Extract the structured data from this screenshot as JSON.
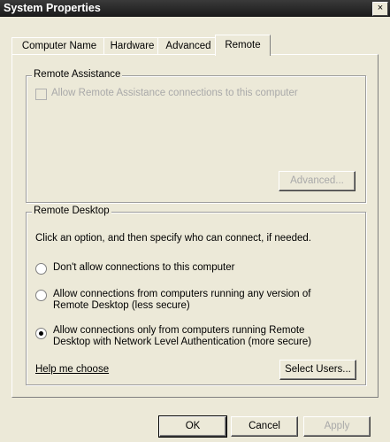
{
  "window": {
    "title": "System Properties",
    "close_glyph": "×"
  },
  "tabs": [
    {
      "label": "Computer Name",
      "active": false
    },
    {
      "label": "Hardware",
      "active": false
    },
    {
      "label": "Advanced",
      "active": false
    },
    {
      "label": "Remote",
      "active": true
    }
  ],
  "remote_assistance": {
    "legend": "Remote Assistance",
    "checkbox_label": "Allow Remote Assistance connections to this computer",
    "checkbox_checked": false,
    "advanced_button": "Advanced..."
  },
  "remote_desktop": {
    "legend": "Remote Desktop",
    "instruction": "Click an option, and then specify who can connect, if needed.",
    "options": [
      {
        "line1": "Don't allow connections to this computer",
        "line2": "",
        "selected": false
      },
      {
        "line1": "Allow connections from computers running any version of",
        "line2": "Remote Desktop (less secure)",
        "selected": false
      },
      {
        "line1": "Allow connections only from computers running Remote",
        "line2": "Desktop with Network Level Authentication (more secure)",
        "selected": true
      }
    ],
    "help_link": "Help me choose",
    "select_users_button": "Select Users..."
  },
  "footer": {
    "ok_label": "OK",
    "cancel_label": "Cancel",
    "apply_label": "Apply"
  }
}
